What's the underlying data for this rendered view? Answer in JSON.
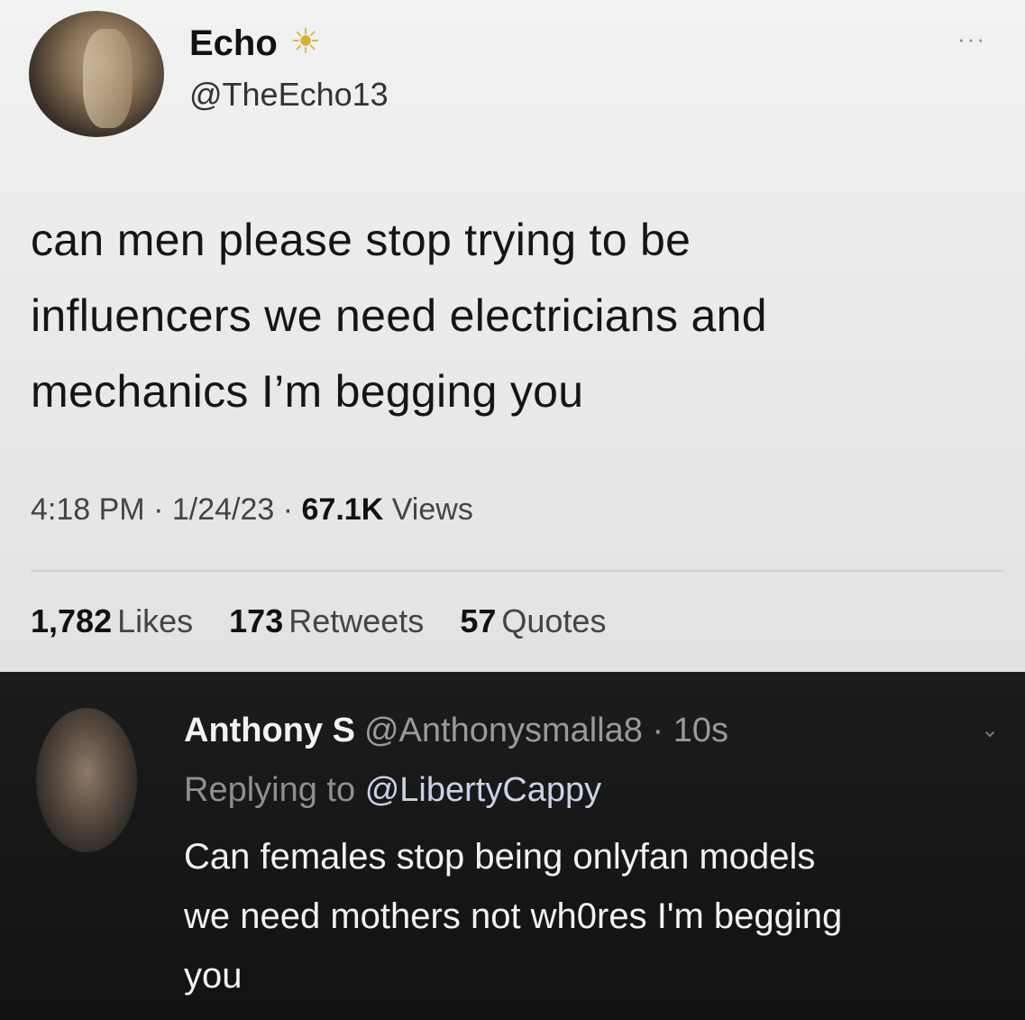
{
  "tweet": {
    "name": "Echo",
    "badge_icon": "sun-icon",
    "handle": "@TheEcho13",
    "more_label": "···",
    "text_lines": [
      "can men please stop trying to be",
      "influencers we need electricians and",
      "mechanics I’m begging you"
    ],
    "time": "4:18 PM",
    "date": "1/24/23",
    "views_count": "67.1K",
    "views_label": "Views",
    "separator": "·",
    "likes_count": "1,782",
    "likes_label": "Likes",
    "retweets_count": "173",
    "retweets_label": "Retweets",
    "quotes_count": "57",
    "quotes_label": "Quotes"
  },
  "reply": {
    "name": "Anthony S",
    "handle": "@Anthonysmalla8",
    "age": "10s",
    "replying_prefix": "Replying to",
    "replying_to": "@LibertyCappy",
    "chevron_icon": "chevron-down-icon",
    "text_lines": [
      "Can females stop being onlyfan models",
      "we need mothers not wh0res I'm begging",
      "you"
    ]
  }
}
